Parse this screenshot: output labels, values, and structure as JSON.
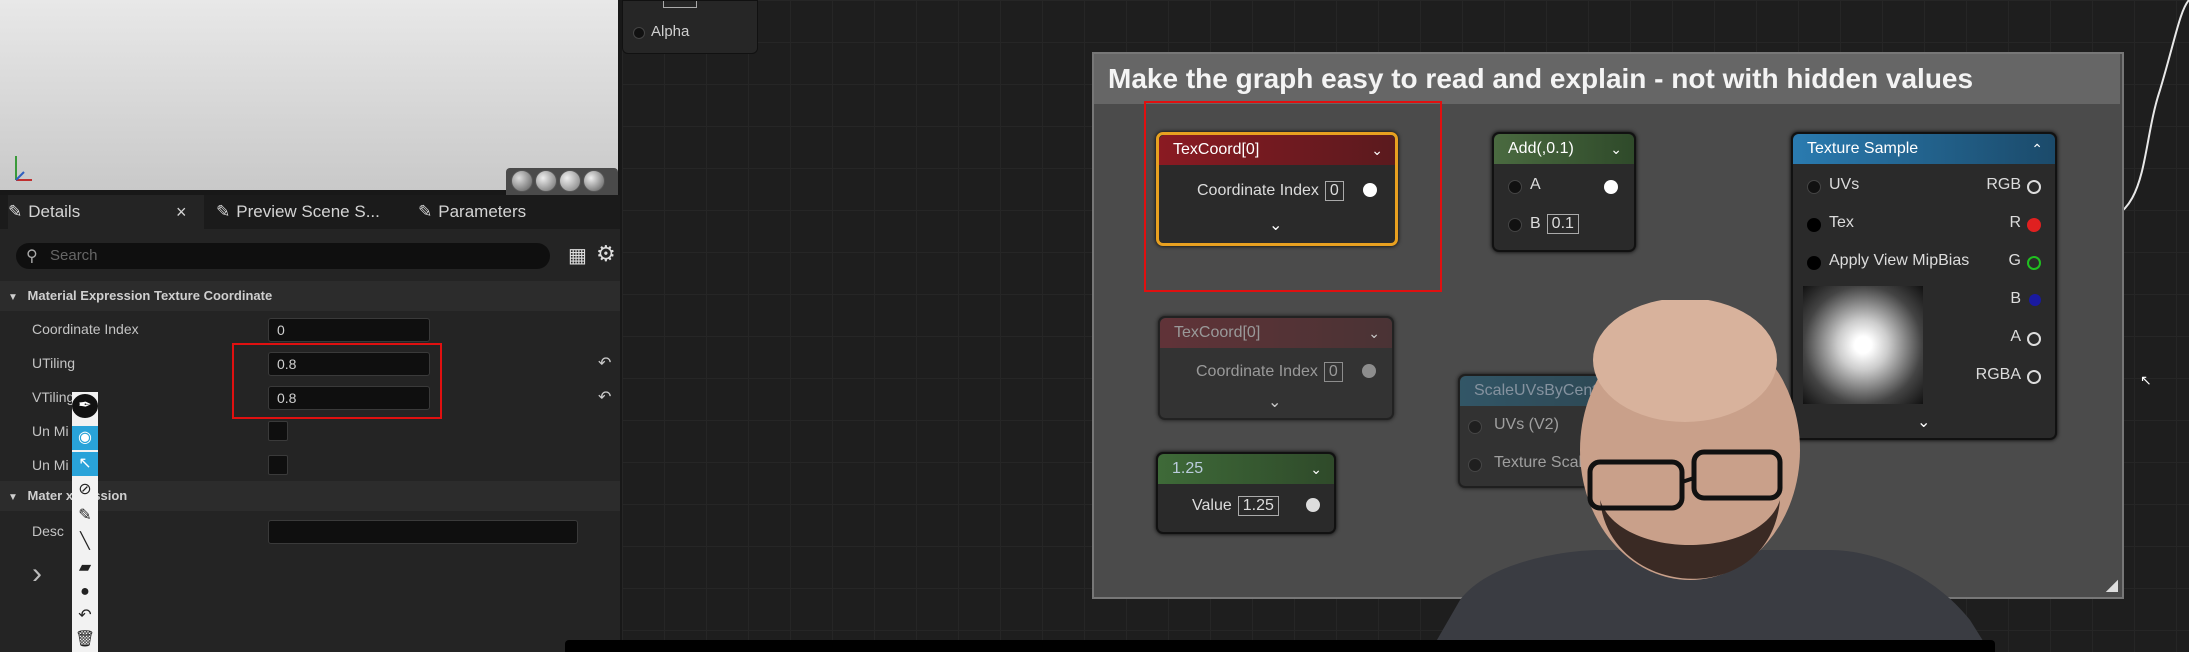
{
  "viewport": {
    "alpha_label": "Alpha"
  },
  "panel": {
    "tabs": [
      {
        "label": "Details",
        "close": "×"
      },
      {
        "label": "Preview Scene S..."
      },
      {
        "label": "Parameters"
      }
    ],
    "search_placeholder": "Search",
    "section1": "Material Expression Texture Coordinate",
    "rows": [
      {
        "label": "Coordinate Index",
        "value": "0"
      },
      {
        "label": "UTiling",
        "value": "0.8"
      },
      {
        "label": "VTiling",
        "value": "0.8"
      },
      {
        "label": "Un Mi"
      },
      {
        "label": "Un Mi"
      }
    ],
    "section2": "Mater   xpression",
    "desc_label": "Desc"
  },
  "graph": {
    "comment_title": "Make the graph easy to read and explain - not with hidden values",
    "nodes": {
      "texcoord1": {
        "title": "TexCoord[0]",
        "pin": "Coordinate Index",
        "value": "0"
      },
      "add": {
        "title": "Add(,0.1)",
        "pin_a": "A",
        "pin_b": "B",
        "b_value": "0.1"
      },
      "texsample": {
        "title": "Texture Sample",
        "in_uvs": "UVs",
        "in_tex": "Tex",
        "in_mip": "Apply View MipBias",
        "out_rgb": "RGB",
        "out_r": "R",
        "out_g": "G",
        "out_b": "B",
        "out_a": "A",
        "out_rgba": "RGBA"
      },
      "texcoord2": {
        "title": "TexCoord[0]",
        "pin": "Coordinate Index",
        "value": "0"
      },
      "scaleuv": {
        "title": "ScaleUVsByCente",
        "pin_uvs": "UVs (V2)",
        "pin_scale": "Texture Scale ("
      },
      "const": {
        "title": "1.25",
        "pin": "Value",
        "value": "1.25"
      }
    }
  },
  "colors": {
    "texcoord_header": "#8a1a22",
    "add_header": "#3a5a30",
    "texsample_header": "#1f5f82",
    "highlight_red": "#e01010",
    "selected_node": "#e8a020"
  }
}
